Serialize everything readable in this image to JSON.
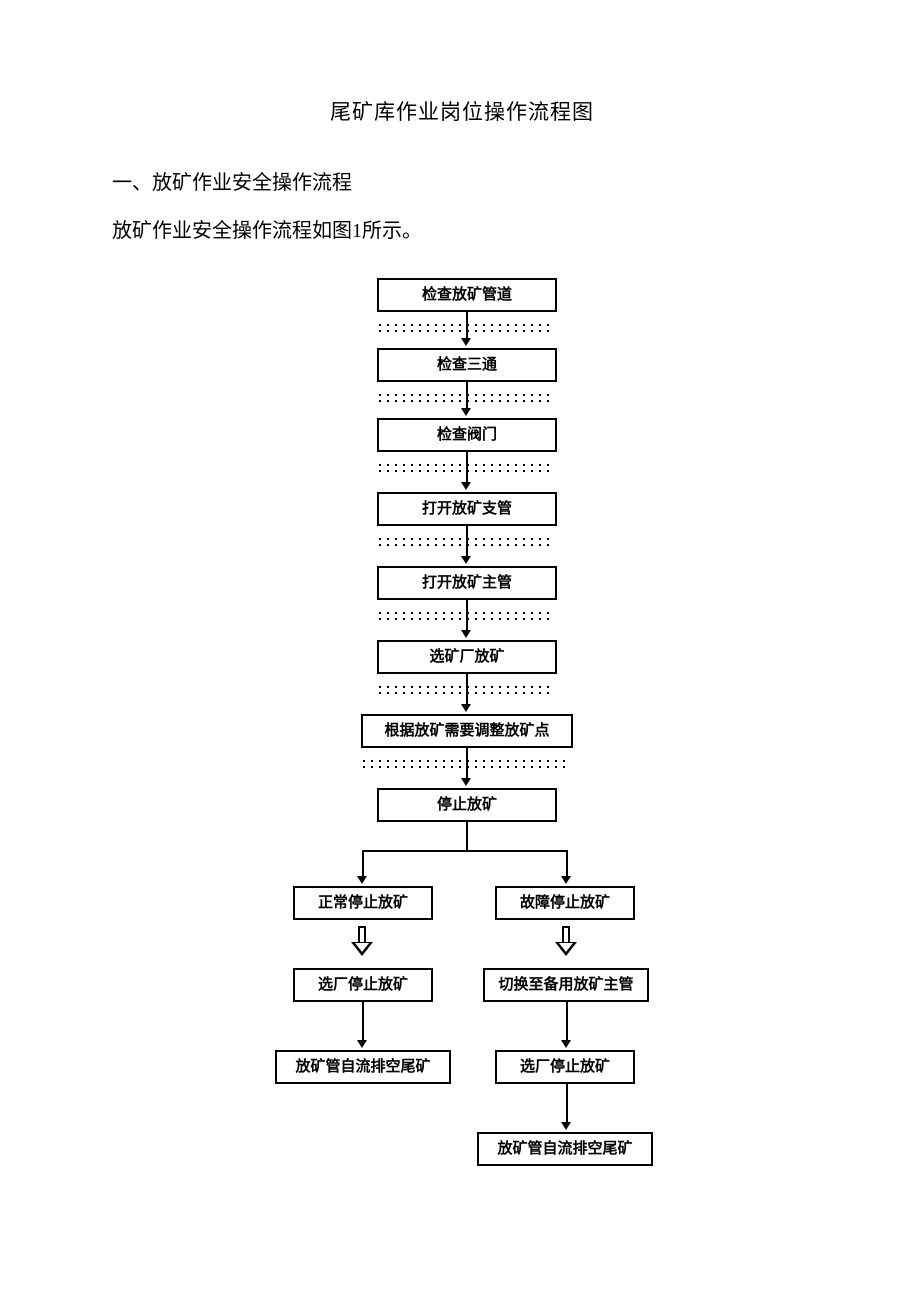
{
  "title": "尾矿库作业岗位操作流程图",
  "section": "一、放矿作业安全操作流程",
  "paragraph": "放矿作业安全操作流程如图1所示。",
  "flow": {
    "n1": "检查放矿管道",
    "n2": "检查三通",
    "n3": "检查阀门",
    "n4": "打开放矿支管",
    "n5": "打开放矿主管",
    "n6": "选矿厂放矿",
    "n7": "根据放矿需要调整放矿点",
    "n8": "停止放矿",
    "left1": "正常停止放矿",
    "left2": "选厂停止放矿",
    "left3": "放矿管自流排空尾矿",
    "right1": "故障停止放矿",
    "right2": "切换至备用放矿主管",
    "right3": "选厂停止放矿",
    "right4": "放矿管自流排空尾矿"
  }
}
